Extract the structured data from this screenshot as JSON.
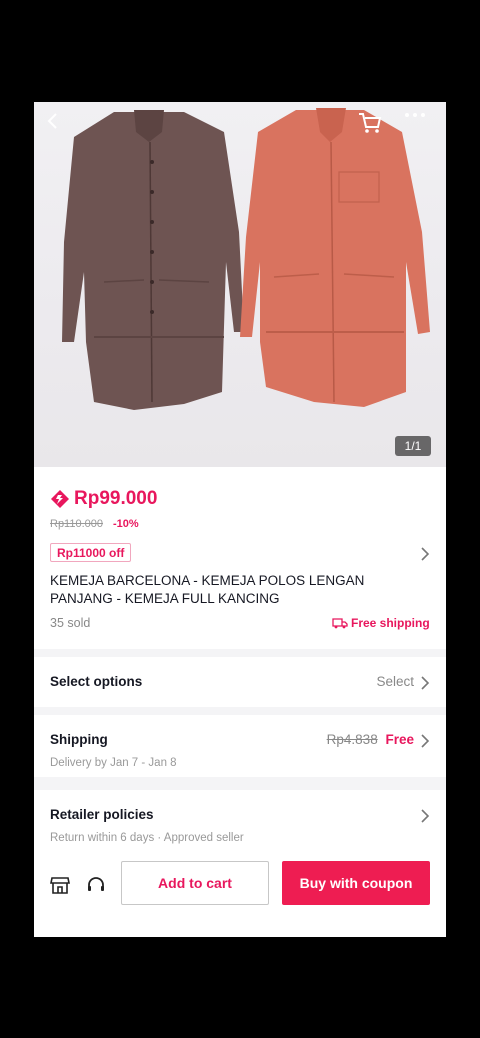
{
  "image_counter": "1/1",
  "product": {
    "price": "Rp99.000",
    "original_price": "Rp110.000",
    "discount": "-10%",
    "coupon": "Rp11000 off",
    "title": "KEMEJA BARCELONA - KEMEJA POLOS LENGAN PANJANG - KEMEJA FULL KANCING",
    "sold": "35 sold",
    "free_shipping": "Free shipping"
  },
  "options": {
    "label": "Select options",
    "value": "Select"
  },
  "shipping": {
    "label": "Shipping",
    "old_cost": "Rp4.838",
    "cost": "Free",
    "delivery": "Delivery by Jan 7 - Jan 8"
  },
  "policies": {
    "label": "Retailer policies",
    "detail": "Return within 6 days · Approved seller"
  },
  "actions": {
    "add_to_cart": "Add to cart",
    "buy": "Buy with coupon"
  },
  "colors": {
    "accent": "#ee1d52",
    "price": "#e8175d"
  }
}
